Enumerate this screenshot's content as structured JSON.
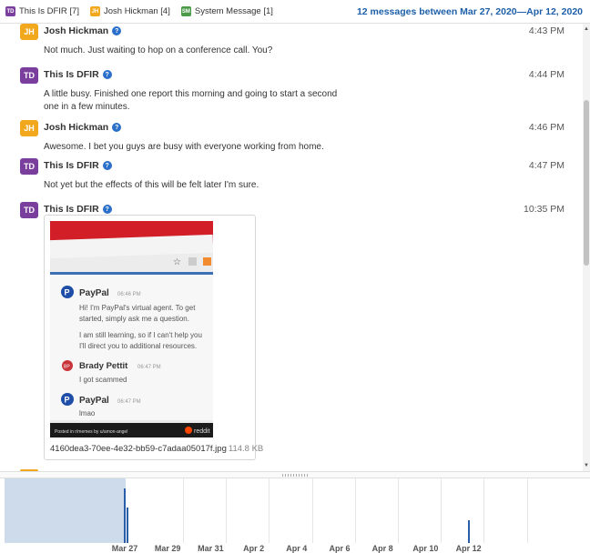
{
  "header": {
    "participants": [
      {
        "initials": "TD",
        "label": "This Is DFIR [7]",
        "color": "#7a3e9d"
      },
      {
        "initials": "JH",
        "label": "Josh Hickman [4]",
        "color": "#f2a81d"
      },
      {
        "initials": "SM",
        "label": "System Message [1]",
        "color": "#4a9a4a"
      }
    ],
    "summary": "12 messages between Mar 27, 2020—Apr 12, 2020"
  },
  "messages": [
    {
      "initials": "JH",
      "color": "#f2a81d",
      "sender": "Josh Hickman",
      "time": "4:43 PM",
      "text": "Not much. Just waiting to hop on a conference call. You?"
    },
    {
      "initials": "TD",
      "color": "#7a3e9d",
      "sender": "This Is DFIR",
      "time": "4:44 PM",
      "text": "A little busy. Finished one report this morning and going to start a second one in a few minutes."
    },
    {
      "initials": "JH",
      "color": "#f2a81d",
      "sender": "Josh Hickman",
      "time": "4:46 PM",
      "text": "Awesome. I bet you guys are busy with everyone working from home."
    },
    {
      "initials": "TD",
      "color": "#7a3e9d",
      "sender": "This Is DFIR",
      "time": "4:47 PM",
      "text": "Not yet but the effects of this will be felt later I'm sure."
    },
    {
      "initials": "TD",
      "color": "#7a3e9d",
      "sender": "This Is DFIR",
      "time": "10:35 PM",
      "attachment": {
        "filename": "4160dea3-70ee-4e32-bb59-c7adaa05017f.jpg",
        "size": "114.8 KB"
      }
    }
  ],
  "screenshot": {
    "agent1": "PayPal",
    "time1": "06:46 PM",
    "text1": "Hi! I'm PayPal's virtual agent. To get started, simply ask me a question.",
    "text2": "I am still learning, so if I can't help you I'll direct you to additional resources.",
    "user": "Brady Pettit",
    "user_initials": "BP",
    "time2": "06:47 PM",
    "user_text": "I got scammed",
    "agent2": "PayPal",
    "time3": "06:47 PM",
    "agent_text2": "lmao",
    "footer_left": "Posted in r/memes by u/amon-angel",
    "footer_right": "reddit"
  },
  "timeline": {
    "ticks": [
      "Mar 27",
      "Mar 29",
      "Mar 31",
      "Apr 2",
      "Apr 4",
      "Apr 6",
      "Apr 8",
      "Apr 10",
      "Apr 12"
    ],
    "activity": [
      {
        "date": "Mar 27",
        "level": 0.85
      },
      {
        "date": "Mar 27",
        "level": 0.55
      },
      {
        "date": "Apr 12",
        "level": 0.35
      }
    ],
    "accent": "#2b5ea8",
    "selection_color": "#cddbeb"
  }
}
